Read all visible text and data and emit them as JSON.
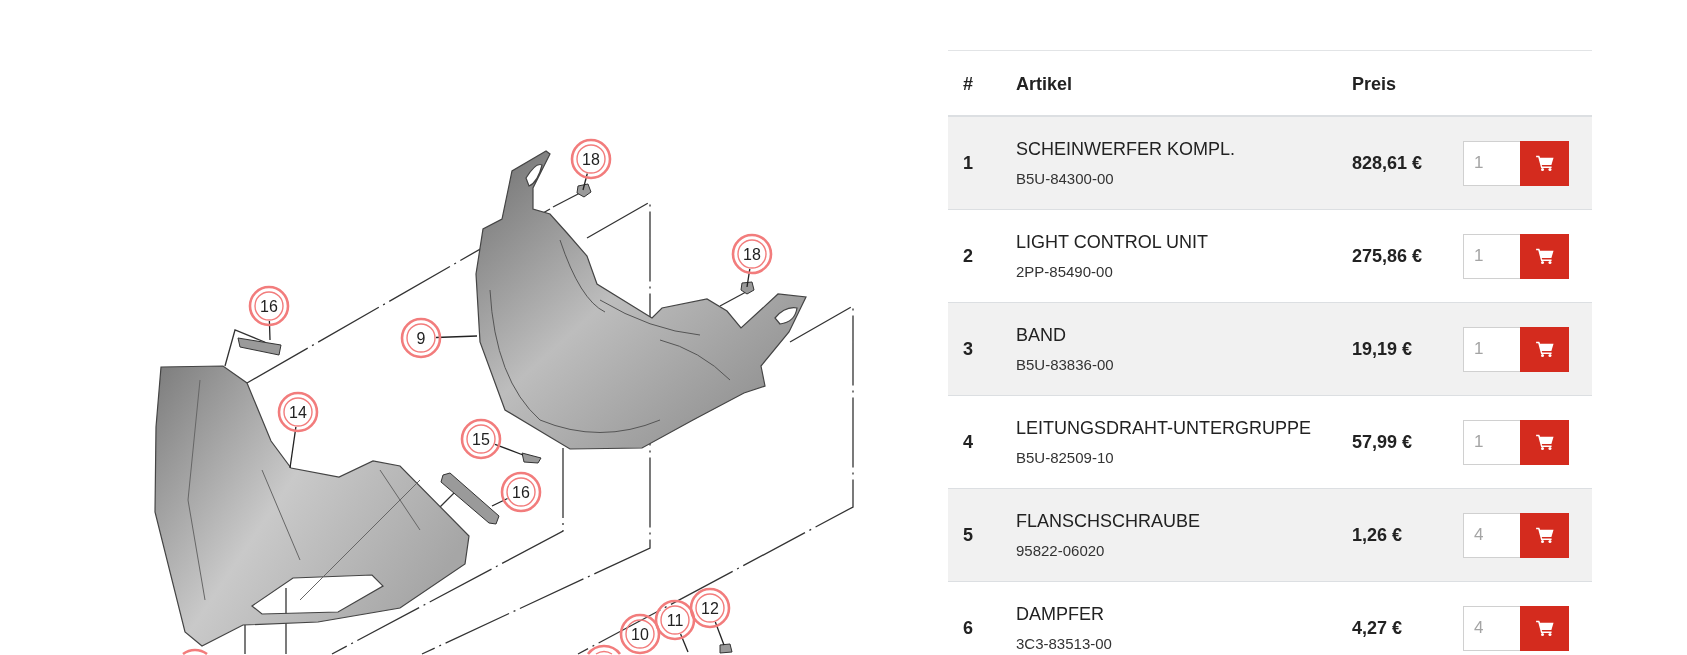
{
  "diagram": {
    "callouts": [
      {
        "number": "18"
      },
      {
        "number": "18"
      },
      {
        "number": "16"
      },
      {
        "number": "9"
      },
      {
        "number": "14"
      },
      {
        "number": "15"
      },
      {
        "number": "16"
      },
      {
        "number": "12"
      },
      {
        "number": "11"
      },
      {
        "number": "10"
      }
    ]
  },
  "table": {
    "columns": [
      "#",
      "Artikel",
      "Preis"
    ],
    "rows": [
      {
        "index": "1",
        "name": "SCHEINWERFER KOMPL.",
        "part_number": "B5U-84300-00",
        "price": "828,61 €",
        "quantity": {
          "placeholder": "1"
        }
      },
      {
        "index": "2",
        "name": "LIGHT CONTROL UNIT",
        "part_number": "2PP-85490-00",
        "price": "275,86 €",
        "quantity": {
          "placeholder": "1"
        }
      },
      {
        "index": "3",
        "name": "BAND",
        "part_number": "B5U-83836-00",
        "price": "19,19 €",
        "quantity": {
          "placeholder": "1"
        }
      },
      {
        "index": "4",
        "name": "LEITUNGSDRAHT-UNTERGRUPPE",
        "part_number": "B5U-82509-10",
        "price": "57,99 €",
        "quantity": {
          "placeholder": "1"
        }
      },
      {
        "index": "5",
        "name": "FLANSCHSCHRAUBE",
        "part_number": "95822-06020",
        "price": "1,26 €",
        "quantity": {
          "placeholder": "4"
        }
      },
      {
        "index": "6",
        "name": "DAMPFER",
        "part_number": "3C3-83513-00",
        "price": "4,27 €",
        "quantity": {
          "placeholder": "4"
        }
      }
    ]
  }
}
